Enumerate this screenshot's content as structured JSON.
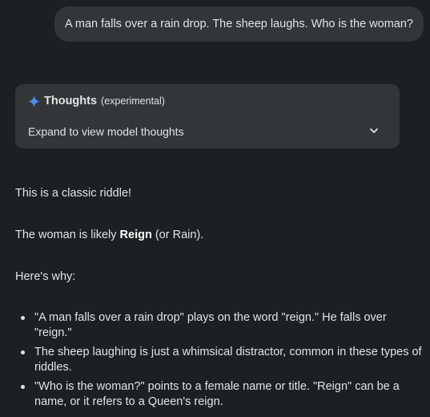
{
  "user_message": "A man falls over a rain drop. The sheep laughs. Who is the woman?",
  "thoughts": {
    "icon": "sparkle-icon",
    "title": "Thoughts",
    "tag": "(experimental)",
    "expand_label": "Expand to view model thoughts",
    "chevron_icon": "chevron-down-icon"
  },
  "response": {
    "intro": "This is a classic riddle!",
    "answer_prefix": "The woman is likely ",
    "answer_bold": "Reign",
    "answer_suffix": " (or Rain).",
    "why_heading": "Here's why:",
    "bullets": [
      "\"A man falls over a rain drop\" plays on the word \"reign.\" He falls over \"reign.\"",
      "The sheep laughing is just a whimsical distractor, common in these types of riddles.",
      "\"Who is the woman?\" points to a female name or title. \"Reign\" can be a name, or it refers to a Queen's reign."
    ]
  },
  "colors": {
    "background": "#1e1f20",
    "bubble": "#333537",
    "text": "#e3e3e3",
    "spark": "#4f8df5"
  }
}
